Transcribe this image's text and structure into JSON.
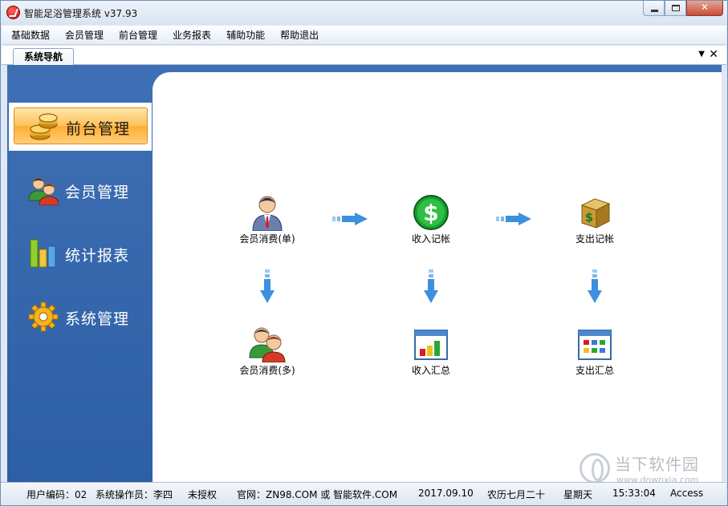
{
  "window": {
    "title": "智能足浴管理系统 v37.93",
    "controls": {
      "minimize": "minimize-icon",
      "maximize": "maximize-icon",
      "close": "✕"
    }
  },
  "menu": [
    "基础数据",
    "会员管理",
    "前台管理",
    "业务报表",
    "辅助功能",
    "帮助退出"
  ],
  "tabs": {
    "active_label": "系统导航",
    "dropdown_glyph": "▼",
    "close_glyph": "✕"
  },
  "sidebar": {
    "items": [
      {
        "label": "前台管理",
        "icon": "coins-icon",
        "active": true
      },
      {
        "label": "会员管理",
        "icon": "members-icon",
        "active": false
      },
      {
        "label": "统计报表",
        "icon": "bar-chart-icon",
        "active": false
      },
      {
        "label": "系统管理",
        "icon": "gear-icon",
        "active": false
      }
    ]
  },
  "flow": {
    "nodes": {
      "member_single": "会员消费(单)",
      "income_record": "收入记帐",
      "expense_record": "支出记帐",
      "member_multi": "会员消费(多)",
      "income_summary": "收入汇总",
      "expense_summary": "支出汇总"
    }
  },
  "status": {
    "user_code": "用户编码：02",
    "operator": "系统操作员：李四",
    "license": "未授权",
    "website": "官网：ZN98.COM 或 智能软件.COM",
    "date": "2017.09.10",
    "lunar": "农历七月二十",
    "weekday": "星期天",
    "time": "15:33:04",
    "db": "Access"
  },
  "watermark": {
    "text": "当下软件园",
    "url": "www.downxia.com"
  },
  "colors": {
    "sidebar": "#3e6fb4",
    "active_pill": "#ffbf55",
    "arrow": "#3d8fe0"
  }
}
